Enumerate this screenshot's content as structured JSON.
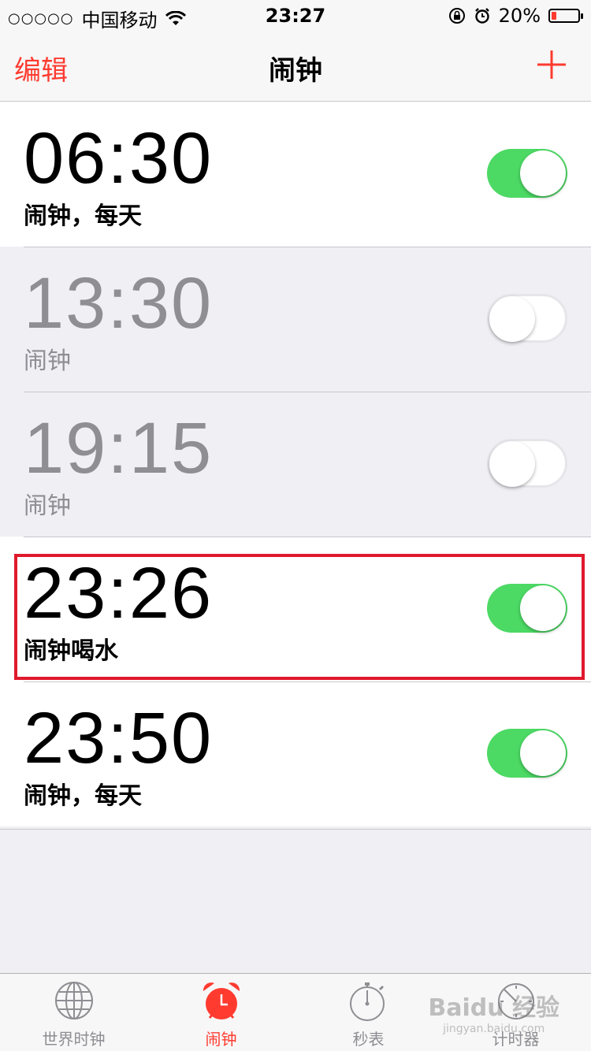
{
  "status_bar": {
    "carrier_dots": "○○○○○",
    "carrier": "中国移动",
    "time": "23:27",
    "battery": "20%",
    "battery_level": 0.2
  },
  "nav": {
    "edit_label": "编辑",
    "title": "闹钟"
  },
  "alarms": [
    {
      "time": "06:30",
      "label": "闹钟，每天",
      "enabled": true
    },
    {
      "time": "13:30",
      "label": "闹钟",
      "enabled": false
    },
    {
      "time": "19:15",
      "label": "闹钟",
      "enabled": false
    },
    {
      "time": "23:26",
      "label": "闹钟喝水",
      "enabled": true
    },
    {
      "time": "23:50",
      "label": "闹钟，每天",
      "enabled": true
    }
  ],
  "tabs": [
    {
      "label": "世界时钟",
      "icon": "globe-icon"
    },
    {
      "label": "闹钟",
      "icon": "alarm-clock-icon",
      "active": true
    },
    {
      "label": "秒表",
      "icon": "stopwatch-icon"
    },
    {
      "label": "计时器",
      "icon": "timer-icon"
    }
  ],
  "watermark": {
    "text": "Baidu 经验",
    "sub": "jingyan.baidu.com"
  },
  "colors": {
    "accent": "#ff3b30",
    "toggle_on": "#4cd964",
    "highlight": "#e0192c"
  }
}
